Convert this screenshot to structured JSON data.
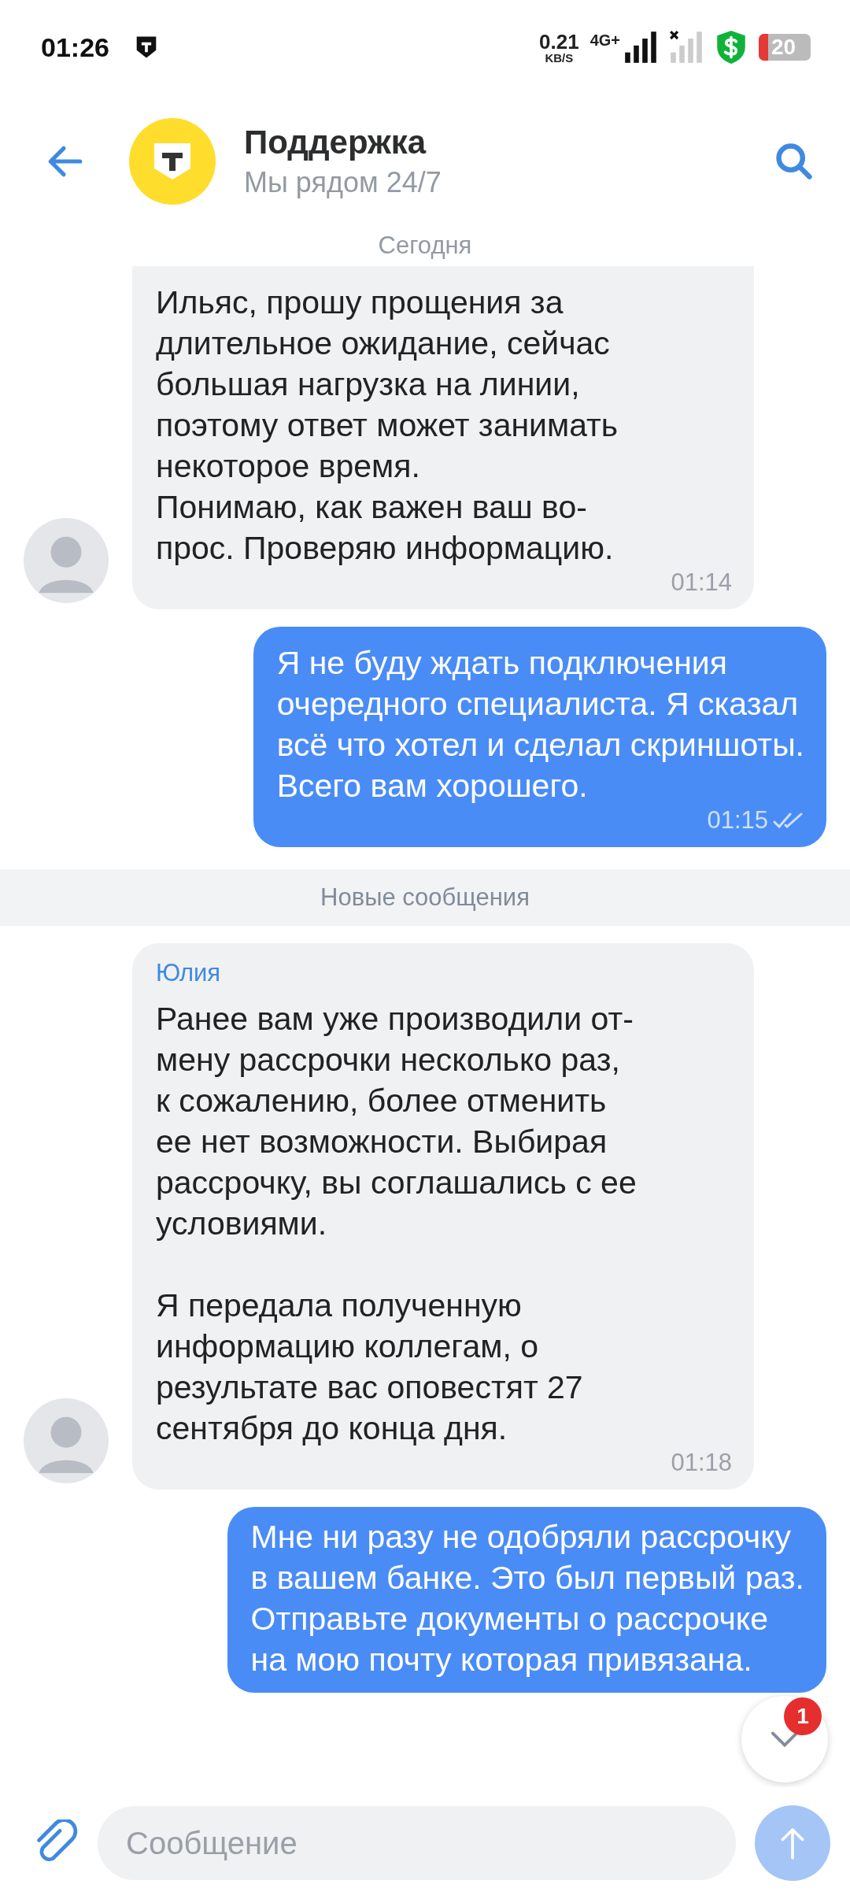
{
  "status_bar": {
    "time": "01:26",
    "speed": "0.21",
    "speed_unit": "KB/S",
    "network": "4G+",
    "battery": "20"
  },
  "header": {
    "title": "Поддержка",
    "subtitle": "Мы рядом 24/7"
  },
  "date_chip": "Сегодня",
  "messages": [
    {
      "kind": "incoming",
      "text": "Ильяс, прошу прощения за\nдлительное ожидание, сейчас\nбольшая нагрузка на линии,\nпоэтому ответ может занимать\nнекоторое время.\nПонимаю, как важен ваш во-\nпрос. Проверяю информацию.",
      "time": "01:14",
      "clipped_top": true
    },
    {
      "kind": "outgoing",
      "text": "Я не буду ждать подключения\nочередного специалиста. Я сказал\nвсё что хотел и сделал скриншоты.\nВсего вам хорошего.",
      "time": "01:15",
      "read": true
    },
    {
      "kind": "divider",
      "text": "Новые сообщения"
    },
    {
      "kind": "incoming",
      "sender": "Юлия",
      "text": "Ранее вам уже производили от-\nмену рассрочки несколько раз,\nк сожалению, более отменить\nее нет возможности. Выбирая\nрассрочку, вы соглашались с ее\nусловиями.\n\nЯ передала полученную\nинформацию коллегам, о\nрезультате вас оповестят 27\nсентября до конца дня.",
      "time": "01:18",
      "clipped_top": false
    },
    {
      "kind": "outgoing",
      "text": "Мне ни разу не одобряли рассрочку\nв вашем банке. Это был первый раз.\nОтправьте документы о рассрочке\nна мою почту которая привязана."
    }
  ],
  "scroll_button": {
    "badge": "1"
  },
  "composer": {
    "placeholder": "Сообщение"
  }
}
